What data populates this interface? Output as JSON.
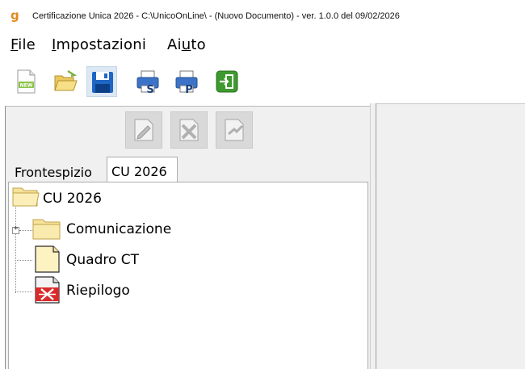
{
  "window": {
    "title": "Certificazione Unica 2026 - C:\\UnicoOnLine\\ - (Nuovo Documento)  -  ver. 1.0.0 del 09/02/2026",
    "logo_glyph": "g"
  },
  "menu": {
    "file": {
      "first": "F",
      "rest": "ile"
    },
    "impostazioni": {
      "first": "I",
      "rest": "mpostazioni"
    },
    "aiuto": {
      "pre": "Ai",
      "u": "u",
      "post": "to"
    }
  },
  "toolbar": {
    "icons": [
      "new-document-icon",
      "open-folder-icon",
      "save-floppy-icon",
      "print-s-icon",
      "print-p-icon",
      "exit-icon"
    ],
    "new_badge": "NEW",
    "print_s_letter": "S",
    "print_p_letter": "P"
  },
  "edit_tools": {
    "icons": [
      "edit-icon",
      "delete-icon",
      "confirm-icon"
    ]
  },
  "tabs": [
    {
      "label": "Frontespizio",
      "active": false
    },
    {
      "label": "CU 2026",
      "active": true
    }
  ],
  "tree": {
    "root": {
      "label": "CU 2026",
      "icon": "folder-open-icon"
    },
    "children": [
      {
        "label": "Comunicazione",
        "icon": "folder-icon",
        "expandable": true,
        "expander": "+"
      },
      {
        "label": "Quadro CT",
        "icon": "document-icon",
        "expandable": false
      },
      {
        "label": "Riepilogo",
        "icon": "document-error-icon",
        "expandable": false
      }
    ]
  },
  "colors": {
    "panel_bg": "#f0f0f0",
    "accent_orange": "#e08a1e",
    "folder_yellow": "#f6e39a",
    "save_blue": "#1f66c4",
    "exit_green": "#3e9a2e",
    "error_red": "#d82b2b"
  }
}
